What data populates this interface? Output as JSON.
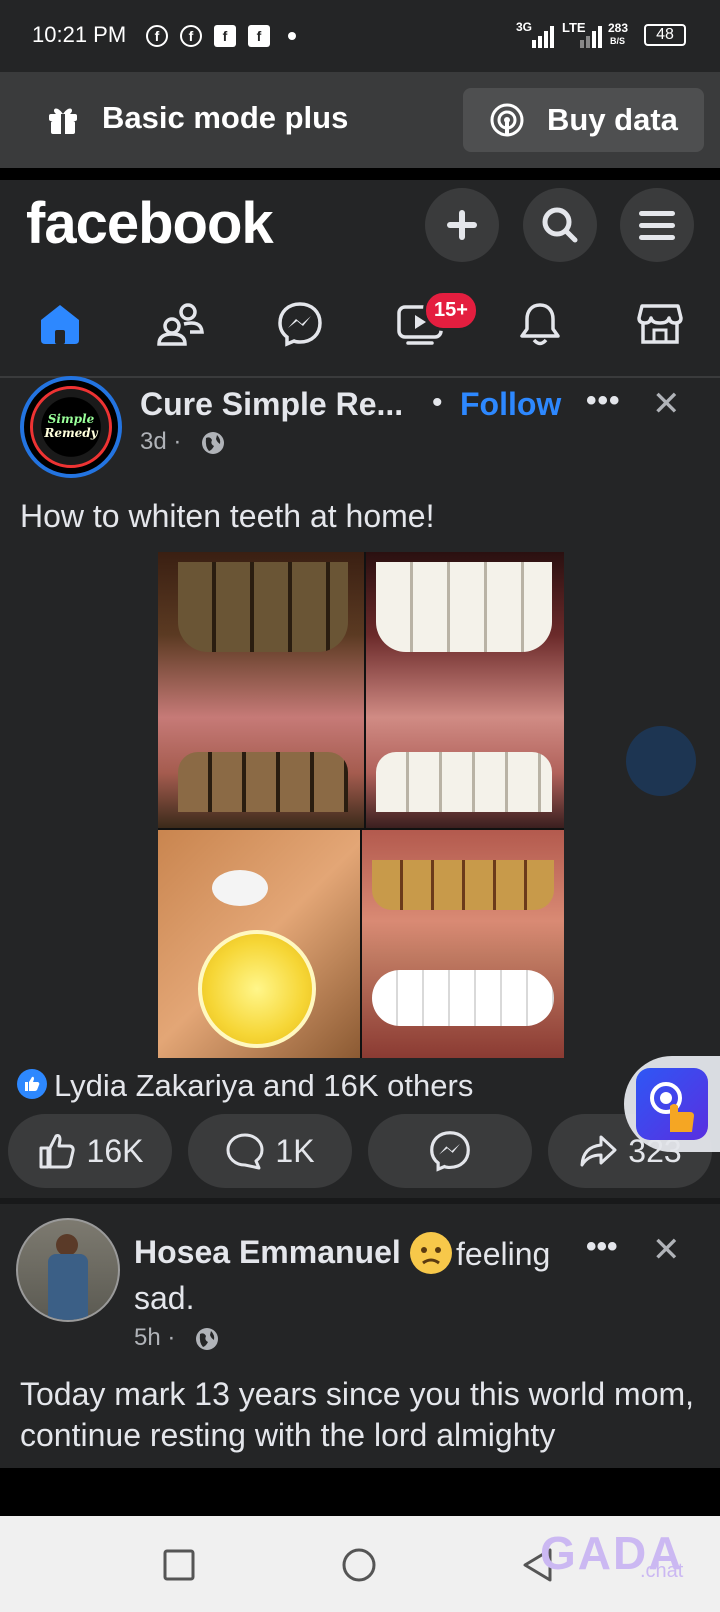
{
  "status_bar": {
    "time": "10:21 PM",
    "network1": "3G",
    "network2": "LTE",
    "speed_value": "283",
    "speed_unit": "B/S",
    "battery": "48"
  },
  "basic_mode": {
    "label": "Basic mode plus",
    "buy_data_label": "Buy data"
  },
  "header": {
    "logo": "facebook",
    "icons": [
      "plus-icon",
      "search-icon",
      "menu-icon"
    ]
  },
  "tabs": {
    "video_badge": "15+",
    "items": [
      "home",
      "friends",
      "messenger",
      "video",
      "notifications",
      "marketplace"
    ]
  },
  "post1": {
    "page_name": "Cure Simple Re...",
    "avatar_line1": "Simple",
    "avatar_line2": "Remedy",
    "follow_label": "Follow",
    "time": "3d",
    "text": "How to whiten teeth at home!",
    "reactions_text": "Lydia Zakariya and 16K others",
    "like_count": "16K",
    "comment_count": "1K",
    "share_count": "323"
  },
  "post2": {
    "author": "Hosea Emmanuel",
    "feeling": "feeling",
    "feeling_word": "sad.",
    "time": "5h",
    "text": "Today mark 13 years since you this world mom, continue resting with the lord almighty"
  },
  "watermark": {
    "line1": "GADA",
    "line2": ".chat"
  },
  "colors": {
    "background": "#242526",
    "accent_blue": "#2d88ff",
    "badge_red": "#e41e3f"
  }
}
